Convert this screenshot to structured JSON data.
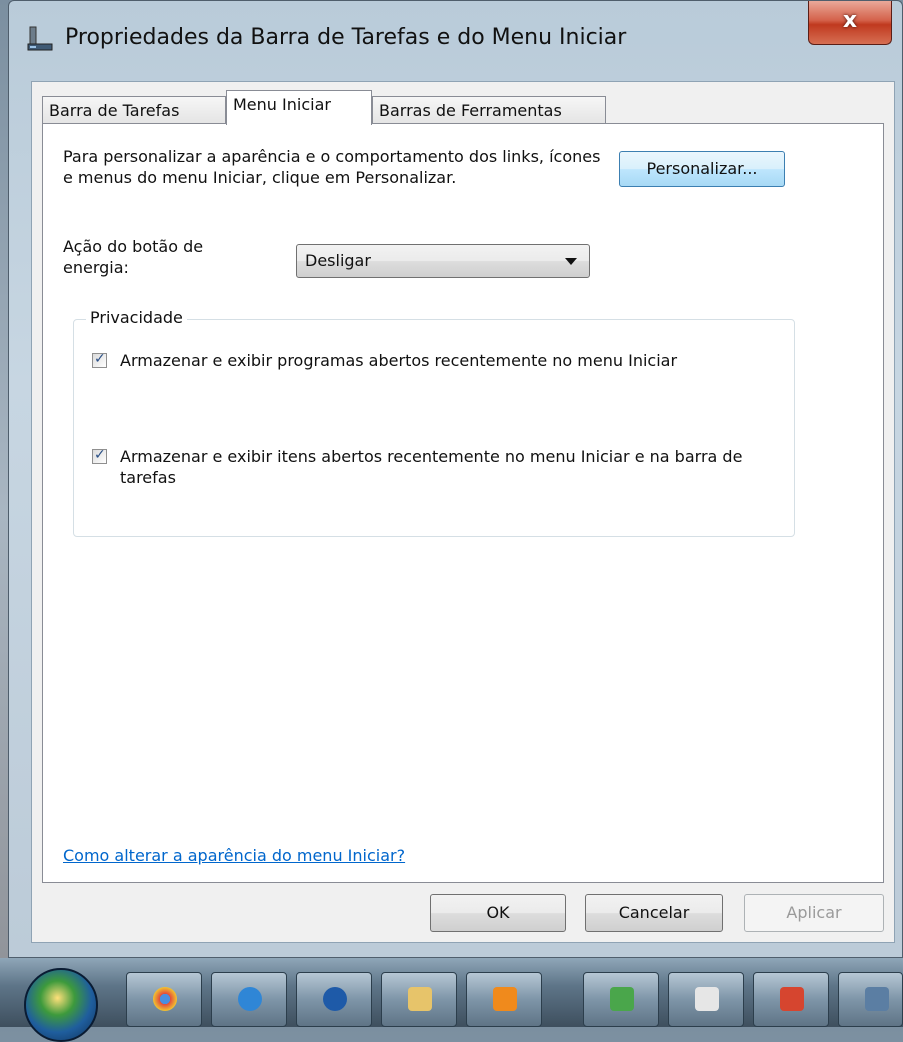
{
  "window": {
    "title": "Propriedades da Barra de Tarefas e do Menu Iniciar",
    "close_label": "x"
  },
  "tabs": [
    {
      "label": "Barra de Tarefas",
      "active": false
    },
    {
      "label": "Menu Iniciar",
      "active": true
    },
    {
      "label": "Barras de Ferramentas",
      "active": false
    }
  ],
  "content": {
    "description": "Para personalizar a aparência e o comportamento dos links, ícones e menus do menu Iniciar, clique em Personalizar.",
    "customize_button": "Personalizar...",
    "power_label": "Ação do botão de energia:",
    "power_select_value": "Desligar",
    "privacy_group_title": "Privacidade",
    "privacy_options": [
      {
        "label": "Armazenar e exibir programas abertos recentemente no menu Iniciar",
        "checked": true
      },
      {
        "label": "Armazenar e exibir itens abertos recentemente no menu Iniciar e na barra de tarefas",
        "checked": true
      }
    ],
    "help_link": "Como alterar a aparência do menu Iniciar?"
  },
  "footer": {
    "ok_label": "OK",
    "cancel_label": "Cancelar",
    "apply_label": "Aplicar"
  },
  "taskbar": {
    "icons": [
      "chrome-icon",
      "internet-explorer-icon",
      "media-icon",
      "file-explorer-icon",
      "orange-app-icon",
      "network-icon",
      "paint-icon",
      "red-app-icon",
      "window-icon"
    ]
  },
  "colors": {
    "link": "#0066cc",
    "close_button": "#c7442b",
    "focused_button": "#3c7fb1"
  }
}
